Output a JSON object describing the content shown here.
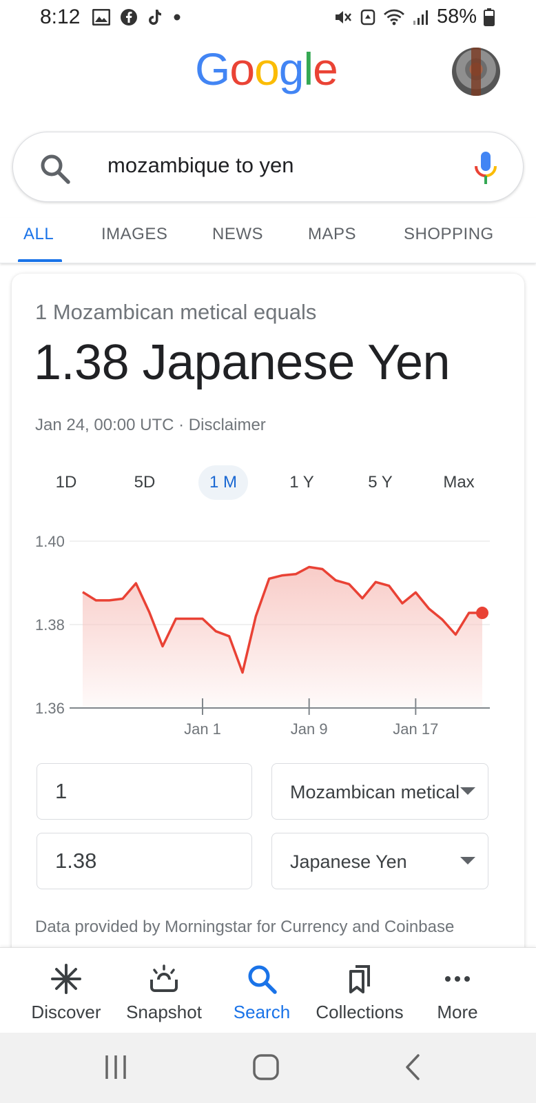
{
  "status_bar": {
    "time": "8:12",
    "battery": "58%",
    "left_icons": [
      "gallery-icon",
      "facebook-icon",
      "tiktok-icon",
      "dot-icon"
    ],
    "right_icons": [
      "mute-icon",
      "recycle-icon",
      "wifi-icon",
      "signal-icon",
      "battery-icon"
    ]
  },
  "header": {
    "logo": [
      "G",
      "o",
      "o",
      "g",
      "l",
      "e"
    ],
    "logo_colors": [
      "#4285F4",
      "#EA4335",
      "#FBBC05",
      "#4285F4",
      "#34A853",
      "#EA4335"
    ]
  },
  "search": {
    "query": "mozambique to yen"
  },
  "tabs": [
    {
      "label": "ALL",
      "active": true
    },
    {
      "label": "IMAGES",
      "active": false
    },
    {
      "label": "NEWS",
      "active": false
    },
    {
      "label": "MAPS",
      "active": false
    },
    {
      "label": "SHOPPING",
      "active": false
    }
  ],
  "converter": {
    "equals_label": "1 Mozambican metical equals",
    "result": "1.38 Japanese Yen",
    "date_line": "Jan 24, 00:00 UTC · Disclaimer",
    "ranges": [
      "1D",
      "5D",
      "1 M",
      "1 Y",
      "5 Y",
      "Max"
    ],
    "active_range": "1 M",
    "from_amount": "1",
    "from_currency": "Mozambican metical",
    "to_amount": "1.38",
    "to_currency": "Japanese Yen",
    "footnote": "Data provided by Morningstar for Currency and Coinbase"
  },
  "chart_data": {
    "type": "area",
    "title": "",
    "xlabel": "",
    "ylabel": "",
    "ylim": [
      1.36,
      1.4
    ],
    "yticks": [
      "1.40",
      "1.38",
      "1.36"
    ],
    "xticks": [
      "Jan 1",
      "Jan 9",
      "Jan 17"
    ],
    "xtick_index": [
      9,
      17,
      25
    ],
    "x_range": [
      0,
      30
    ],
    "values": [
      1.3878,
      1.3858,
      1.3858,
      1.3862,
      1.3899,
      1.383,
      1.3748,
      1.3814,
      1.3814,
      1.3814,
      1.3784,
      1.3772,
      1.3685,
      1.382,
      1.391,
      1.3918,
      1.3921,
      1.3938,
      1.3933,
      1.3906,
      1.3897,
      1.3863,
      1.3902,
      1.3893,
      1.3851,
      1.3877,
      1.3838,
      1.3812,
      1.3776,
      1.3828,
      1.3828
    ],
    "line_color": "#E94235",
    "fill_color": "#F7C3BE",
    "grid": true
  },
  "bottom_nav": [
    {
      "label": "Discover",
      "icon": "discover-icon",
      "active": false
    },
    {
      "label": "Snapshot",
      "icon": "snapshot-icon",
      "active": false
    },
    {
      "label": "Search",
      "icon": "search-icon",
      "active": true
    },
    {
      "label": "Collections",
      "icon": "collections-icon",
      "active": false
    },
    {
      "label": "More",
      "icon": "more-icon",
      "active": false
    }
  ],
  "system_nav": [
    "recent-apps-icon",
    "home-icon",
    "back-icon"
  ]
}
